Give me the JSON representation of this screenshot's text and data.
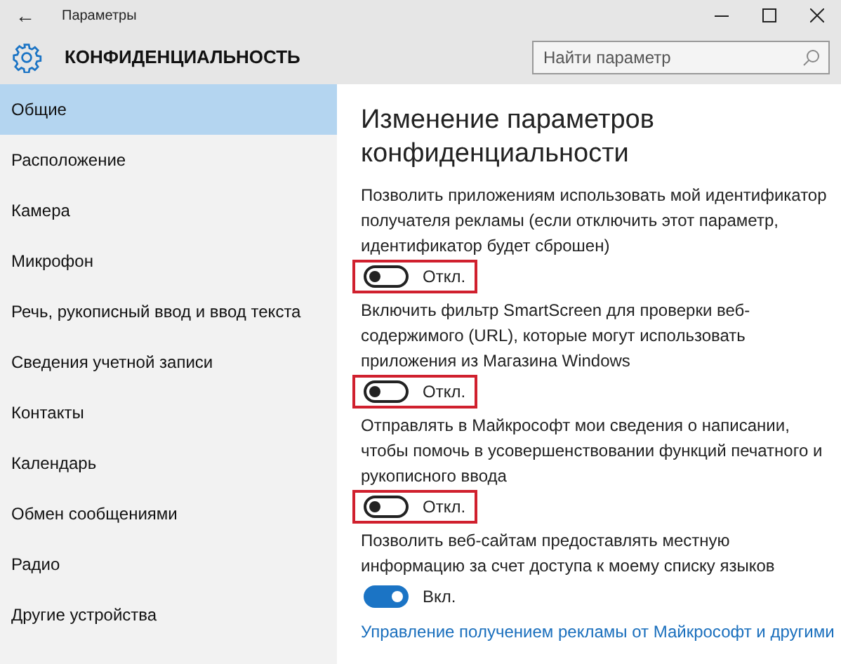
{
  "window": {
    "title": "Параметры",
    "back": "←"
  },
  "header": {
    "title": "КОНФИДЕНЦИАЛЬНОСТЬ",
    "search": {
      "placeholder": "Найти параметр"
    }
  },
  "sidebar": {
    "items": [
      {
        "label": "Общие",
        "selected": true
      },
      {
        "label": "Расположение",
        "selected": false
      },
      {
        "label": "Камера",
        "selected": false
      },
      {
        "label": "Микрофон",
        "selected": false
      },
      {
        "label": "Речь, рукописный ввод и ввод текста",
        "selected": false
      },
      {
        "label": "Сведения учетной записи",
        "selected": false
      },
      {
        "label": "Контакты",
        "selected": false
      },
      {
        "label": "Календарь",
        "selected": false
      },
      {
        "label": "Обмен сообщениями",
        "selected": false
      },
      {
        "label": "Радио",
        "selected": false
      },
      {
        "label": "Другие устройства",
        "selected": false
      }
    ]
  },
  "content": {
    "heading": "Изменение параметров конфиденциальности",
    "settings": [
      {
        "description": "Позволить приложениям использовать мой идентификатор получателя рекламы (если отключить этот параметр, идентификатор будет сброшен)",
        "on": false,
        "state": "Откл.",
        "highlighted": true
      },
      {
        "description": "Включить фильтр SmartScreen для проверки веб-содержимого (URL), которые могут использовать приложения из Магазина Windows",
        "on": false,
        "state": "Откл.",
        "highlighted": true
      },
      {
        "description": "Отправлять в Майкрософт мои сведения о написании, чтобы помочь в усовершенствовании функций печатного и рукописного ввода",
        "on": false,
        "state": "Откл.",
        "highlighted": true
      },
      {
        "description": "Позволить веб-сайтам предоставлять местную информацию за счет доступа к моему списку языков",
        "on": true,
        "state": "Вкл.",
        "highlighted": false
      }
    ],
    "link": "Управление получением рекламы от Майкрософт и другими"
  }
}
